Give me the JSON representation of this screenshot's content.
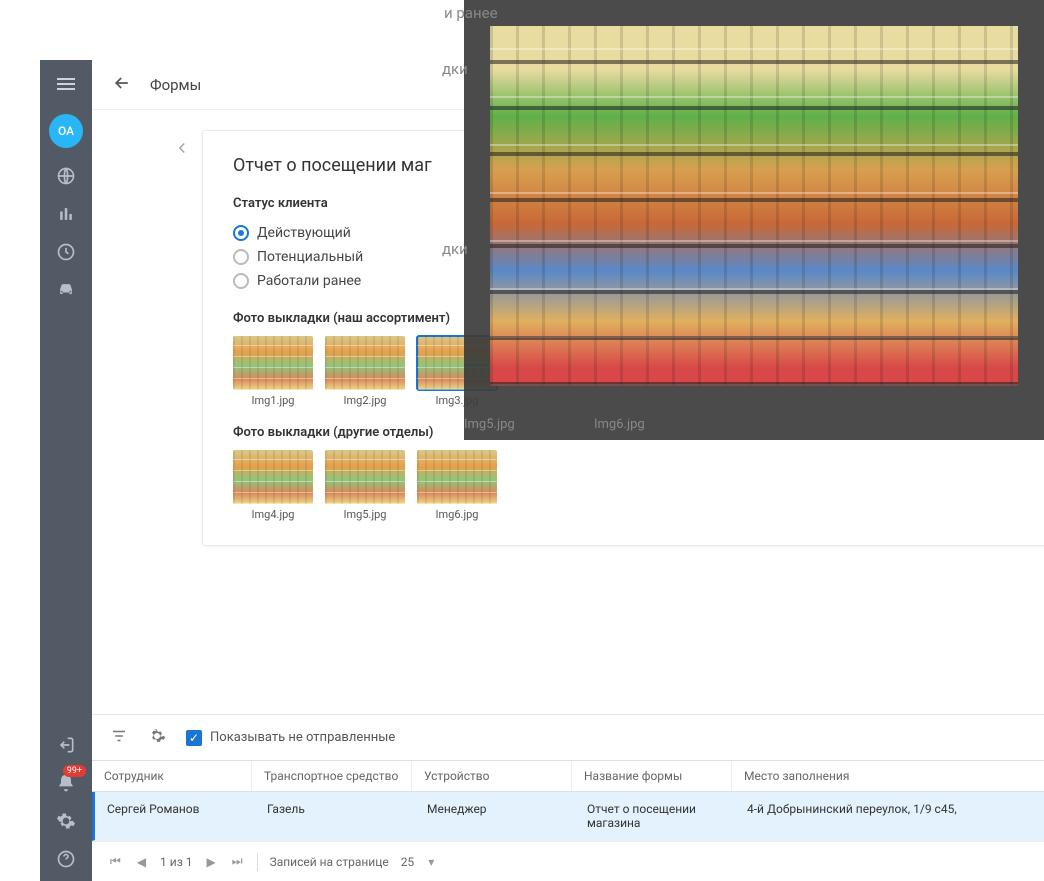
{
  "sidebar": {
    "avatar_initials": "ОА",
    "notif_count": "99+"
  },
  "topbar": {
    "title": "Формы"
  },
  "panel": {
    "title": "Отчет о посещении маг",
    "status_label": "Статус клиента",
    "status_options": [
      "Действующий",
      "Потенциальный",
      "Работали ранее"
    ],
    "status_selected": 0,
    "photo_group1_label": "Фото выкладки (наш ассортимент)",
    "photo_group1": [
      "Img1.jpg",
      "Img2.jpg",
      "Img3.jpg"
    ],
    "photo_group1_selected": 2,
    "photo_group2_label": "Фото выкладки (другие отделы)",
    "photo_group2": [
      "Img4.jpg",
      "Img5.jpg",
      "Img6.jpg"
    ]
  },
  "overlay": {
    "behind_text_top": "и ранее",
    "behind_text_mid": "дки",
    "behind_thumbs": [
      "Img5.jpg",
      "Img6.jpg"
    ]
  },
  "toolbar": {
    "show_unsent_label": "Показывать не отправленные",
    "show_unsent_checked": true
  },
  "grid": {
    "columns": [
      "Сотрудник",
      "Транспортное средство",
      "Устройство",
      "Название формы",
      "Место заполнения"
    ],
    "rows": [
      {
        "employee": "Сергей Романов",
        "vehicle": "Газель",
        "device": "Менеджер",
        "form_name": "Отчет о посещении магазина",
        "place": "4-й Добрынинский переулок, 1/9 с45,"
      }
    ]
  },
  "pager": {
    "page_text": "1 из 1",
    "records_label": "Записей на странице",
    "page_size": "25"
  }
}
